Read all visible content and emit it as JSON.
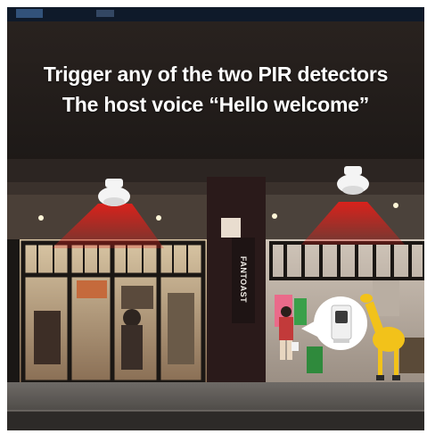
{
  "caption": {
    "line1": "Trigger any of the two PIR detectors",
    "line2": "The host voice “Hello welcome”"
  },
  "storefront": {
    "sign_text": "FANTOAST"
  },
  "colors": {
    "detection_beam": "#e0201a",
    "sign_pillar": "#2a1a1a",
    "giraffe": "#f2c21a"
  },
  "icons": [
    "pir-detector-left-icon",
    "pir-detector-right-icon",
    "doorbell-host-icon",
    "giraffe-statue"
  ]
}
